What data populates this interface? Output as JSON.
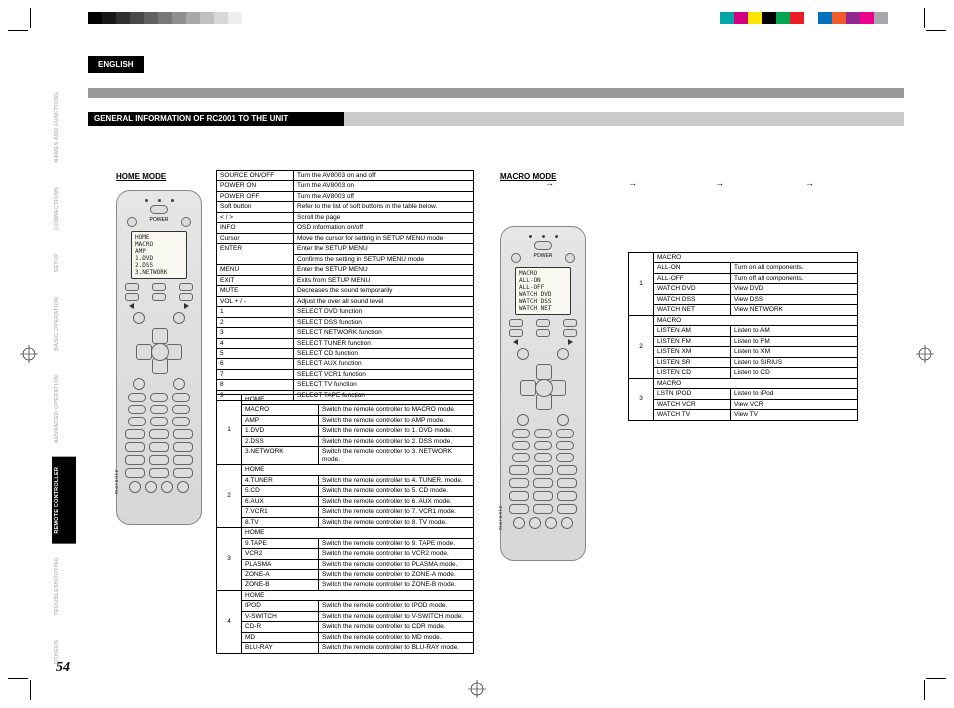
{
  "language": "ENGLISH",
  "page_number": "54",
  "section_title": "GENERAL INFORMATION OF RC2001 TO THE UNIT",
  "side_tabs": [
    "NAMES AND FUNCTIONS",
    "CONNECTIONS",
    "SETUP",
    "BASIC OPERATION",
    "ADVANCED OPERATION",
    "REMOTE CONTROLLER",
    "TROUBLESHOOTING",
    "OTHERS"
  ],
  "side_tabs_active_index": 5,
  "brand": "marantz",
  "home": {
    "heading": "HOME MODE",
    "screen_lines": [
      "HOME",
      "MACRO",
      "AMP",
      "1.DVD",
      "2.DSS",
      "3.NETWORK"
    ],
    "table_a": [
      [
        "SOURCE ON/OFF",
        "Turn the AV8003 on and off"
      ],
      [
        "POWER ON",
        "Turn the AV8003 on"
      ],
      [
        "POWER OFF",
        "Turn the AV8003 off"
      ],
      [
        "Soft button",
        "Refer to the list of soft buttons in the table below."
      ],
      [
        "< / >",
        "Scroll the page"
      ],
      [
        "INFO",
        "OSD information on/off"
      ],
      [
        "Cursor",
        "Move the cursor for setting in SETUP MENU mode"
      ],
      [
        "ENTER",
        "Enter the SETUP MENU\nConfirms the setting in SETUP MENU mode"
      ],
      [
        "MENU",
        "Enter the SETUP MENU"
      ],
      [
        "EXIT",
        "Exits from SETUP MENU"
      ],
      [
        "MUTE",
        "Decreases the sound temporarily"
      ],
      [
        "VOL + / -",
        "Adjust the over all sound level"
      ],
      [
        "1",
        "SELECT DVD function"
      ],
      [
        "2",
        "SELECT DSS function"
      ],
      [
        "3",
        "SELECT NETWORK function"
      ],
      [
        "4",
        "SELECT TUNER function"
      ],
      [
        "5",
        "SELECT CD function"
      ],
      [
        "6",
        "SELECT AUX function"
      ],
      [
        "7",
        "SELECT VCR1 function"
      ],
      [
        "8",
        "SELECT TV function"
      ],
      [
        "9",
        "SELECT TAPE function"
      ]
    ],
    "table_b": [
      {
        "idx": "1",
        "rows": [
          [
            "HOME",
            ""
          ],
          [
            "MACRO",
            "Switch the remote controller to MACRO mode."
          ],
          [
            "AMP",
            "Switch the remote controller to AMP mode."
          ],
          [
            "1.DVD",
            "Switch the remote controller to 1. DVD mode."
          ],
          [
            "2.DSS",
            "Switch the remote controller to 2. DSS mode."
          ],
          [
            "3.NETWORK",
            "Switch the remote controller to 3. NETWORK mode."
          ]
        ]
      },
      {
        "idx": "2",
        "rows": [
          [
            "HOME",
            ""
          ],
          [
            "4.TUNER",
            "Switch the remote controller to 4. TUNER. mode."
          ],
          [
            "5.CD",
            "Switch the remote controller to 5. CD mode."
          ],
          [
            "6.AUX",
            "Switch the remote controller to 6. AUX mode."
          ],
          [
            "7.VCR1",
            "Switch the remote controller to 7. VCR1 mode."
          ],
          [
            "8.TV",
            "Switch the remote controller to 8. TV mode."
          ]
        ]
      },
      {
        "idx": "3",
        "rows": [
          [
            "HOME",
            ""
          ],
          [
            "9.TAPE",
            "Switch the remote controller to 9. TAPE mode."
          ],
          [
            "VCR2",
            "Switch the remote controller to VCR2 mode."
          ],
          [
            "PLASMA",
            "Switch the remote controller to PLASMA mode."
          ],
          [
            "ZONE-A",
            "Switch the remote controller to ZONE-A mode."
          ],
          [
            "ZONE-B",
            "Switch the remote controller to ZONE-B mode."
          ]
        ]
      },
      {
        "idx": "4",
        "rows": [
          [
            "HOME",
            ""
          ],
          [
            "IPOD",
            "Switch the remote controller to IPOD mode."
          ],
          [
            "V-SWITCH",
            "Switch the remote controller to V-SWITCH mode."
          ],
          [
            "CD-R",
            "Switch the remote controller to CDR mode."
          ],
          [
            "MD",
            "Switch the remote controller to MD mode."
          ],
          [
            "BLU-RAY",
            "Switch the remote controller to BLU-RAY mode."
          ]
        ]
      }
    ]
  },
  "macro": {
    "heading": "MACRO MODE",
    "screen_lines": [
      "MACRO",
      "ALL-ON",
      "ALL-OFF",
      "WATCH DVD",
      "WATCH DSS",
      "WATCH NET"
    ],
    "table": [
      {
        "idx": "1",
        "rows": [
          [
            "MACRO",
            ""
          ],
          [
            "ALL-ON",
            "Turn on all components."
          ],
          [
            "ALL-OFF",
            "Turn off all components."
          ],
          [
            "WATCH DVD",
            "View DVD"
          ],
          [
            "WATCH DSS",
            "View DSS"
          ],
          [
            "WATCH NET",
            "View NETWORK"
          ]
        ]
      },
      {
        "idx": "2",
        "rows": [
          [
            "MACRO",
            ""
          ],
          [
            "LISTEN AM",
            "Listen to AM"
          ],
          [
            "LISTEN FM",
            "Listen to FM"
          ],
          [
            "LISTEN XM",
            "Listen to XM"
          ],
          [
            "LISTEN SR",
            "Listen to SIRIUS"
          ],
          [
            "LISTEN CD",
            "Listen to CD"
          ]
        ]
      },
      {
        "idx": "3",
        "rows": [
          [
            "MACRO",
            ""
          ],
          [
            "LSTN IPOD",
            "Listen to iPod"
          ],
          [
            "WATCH VCR",
            "View VCR"
          ],
          [
            "WATCH TV",
            "View TV"
          ]
        ]
      }
    ]
  },
  "colorbar_left_grays": [
    "#000",
    "#181818",
    "#303030",
    "#484848",
    "#606060",
    "#787878",
    "#909090",
    "#a8a8a8",
    "#c0c0c0",
    "#d8d8d8",
    "#eeeeee",
    "#fff"
  ],
  "colorbar_right": [
    "#00a6a6",
    "#d4007f",
    "#ffe600",
    "#000",
    "#00a651",
    "#ed1c24",
    "#fff",
    "#0072bc",
    "#f15a29",
    "#92278f",
    "#ec008c",
    "#a7a9ac"
  ]
}
